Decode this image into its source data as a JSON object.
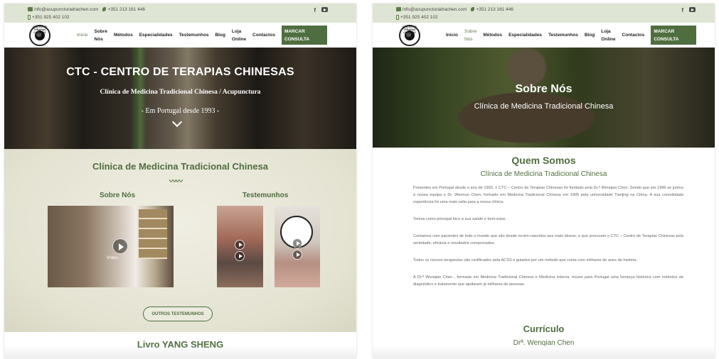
{
  "left": {
    "topbar": {
      "email": "info@acupuncturadrachen.com",
      "phone": "+351 213 161 446",
      "mobile": "+351 925 402 102",
      "social": [
        "facebook-icon",
        "youtube-icon"
      ]
    },
    "nav": {
      "logo_text": "CENTRO DE TERAPIAS CHINESAS",
      "items": [
        {
          "label": "Início",
          "active": true
        },
        {
          "label": "Sobre Nós"
        },
        {
          "label": "Métodos"
        },
        {
          "label": "Especialidades"
        },
        {
          "label": "Testemunhos"
        },
        {
          "label": "Blog"
        },
        {
          "label": "Loja Online"
        },
        {
          "label": "Contactos"
        }
      ],
      "cta": "MARCAR CONSULTA"
    },
    "hero": {
      "title": "CTC - CENTRO DE TERAPIAS CHINESAS",
      "subtitle": "Clínica de Medicina Tradicional Chinesa / Acupunctura",
      "tagline": "- Em Portugal desde 1993 -"
    },
    "section": {
      "title": "Clínica de Medicina Tradicional Chinesa",
      "about_heading": "Sobre Nós",
      "testimonials_heading": "Testemunhos",
      "video_label": "Vídeo",
      "button": "OUTROS TESTEMUNHOS"
    },
    "livro": "Livro YANG SHENG"
  },
  "right": {
    "topbar": {
      "email": "info@acupuncturadrachen.com",
      "phone": "+351 213 161 446",
      "mobile": "+351 925 402 102"
    },
    "nav": {
      "items": [
        {
          "label": "Início"
        },
        {
          "label": "Sobre Nós",
          "active": true
        },
        {
          "label": "Métodos"
        },
        {
          "label": "Especialidades"
        },
        {
          "label": "Testemunhos"
        },
        {
          "label": "Blog"
        },
        {
          "label": "Loja Online"
        },
        {
          "label": "Contactos"
        }
      ],
      "cta": "MARCAR CONSULTA"
    },
    "hero": {
      "title": "Sobre Nós",
      "subtitle": "Clínica de Medicina Tradicional Chinesa"
    },
    "quem_somos": {
      "title": "Quem Somos",
      "subtitle": "Clínica de Medicina Tradicional Chinesa",
      "paragraphs": [
        "Presentes em Portugal desde o ano de 1993, o CTC – Centro de Terapias Chinesas foi fundado pela Dr.ª Wenqian Chen. Sendo que em 1996 se juntou à nossa equipa o Dr. Wennuo Chen, formado em Medicina Tradicional Chinesa em 1995 pela universidade Tianjing na China. A sua consolidada experiência foi uma mais valia para a nossa clínica.",
        "Temos como principal foco a sua saúde e bem-estar.",
        "Contamos com pacientes de todo o mundo que são desde recém-nascidos aos mais idosos, e que procuram o CTC – Centro de Terapias Chinesas pela seriedade, eficácia e resultados comprovados.",
        "Todos os nossos terapeutas são certificados pela ACSS e guiados por um método que conta com milhares de anos de história.",
        "A Dr.ª Wenqian Chen , formada em Medicina Tradicional Chinesa e Medicina Interna, trouxe para Portugal uma herança histórica com métodos de diagnóstico e tratamento que ajudaram já milhares de pessoas."
      ]
    },
    "curriculo": {
      "title": "Currículo",
      "subtitle": "Drª. Wenqian Chen"
    }
  }
}
